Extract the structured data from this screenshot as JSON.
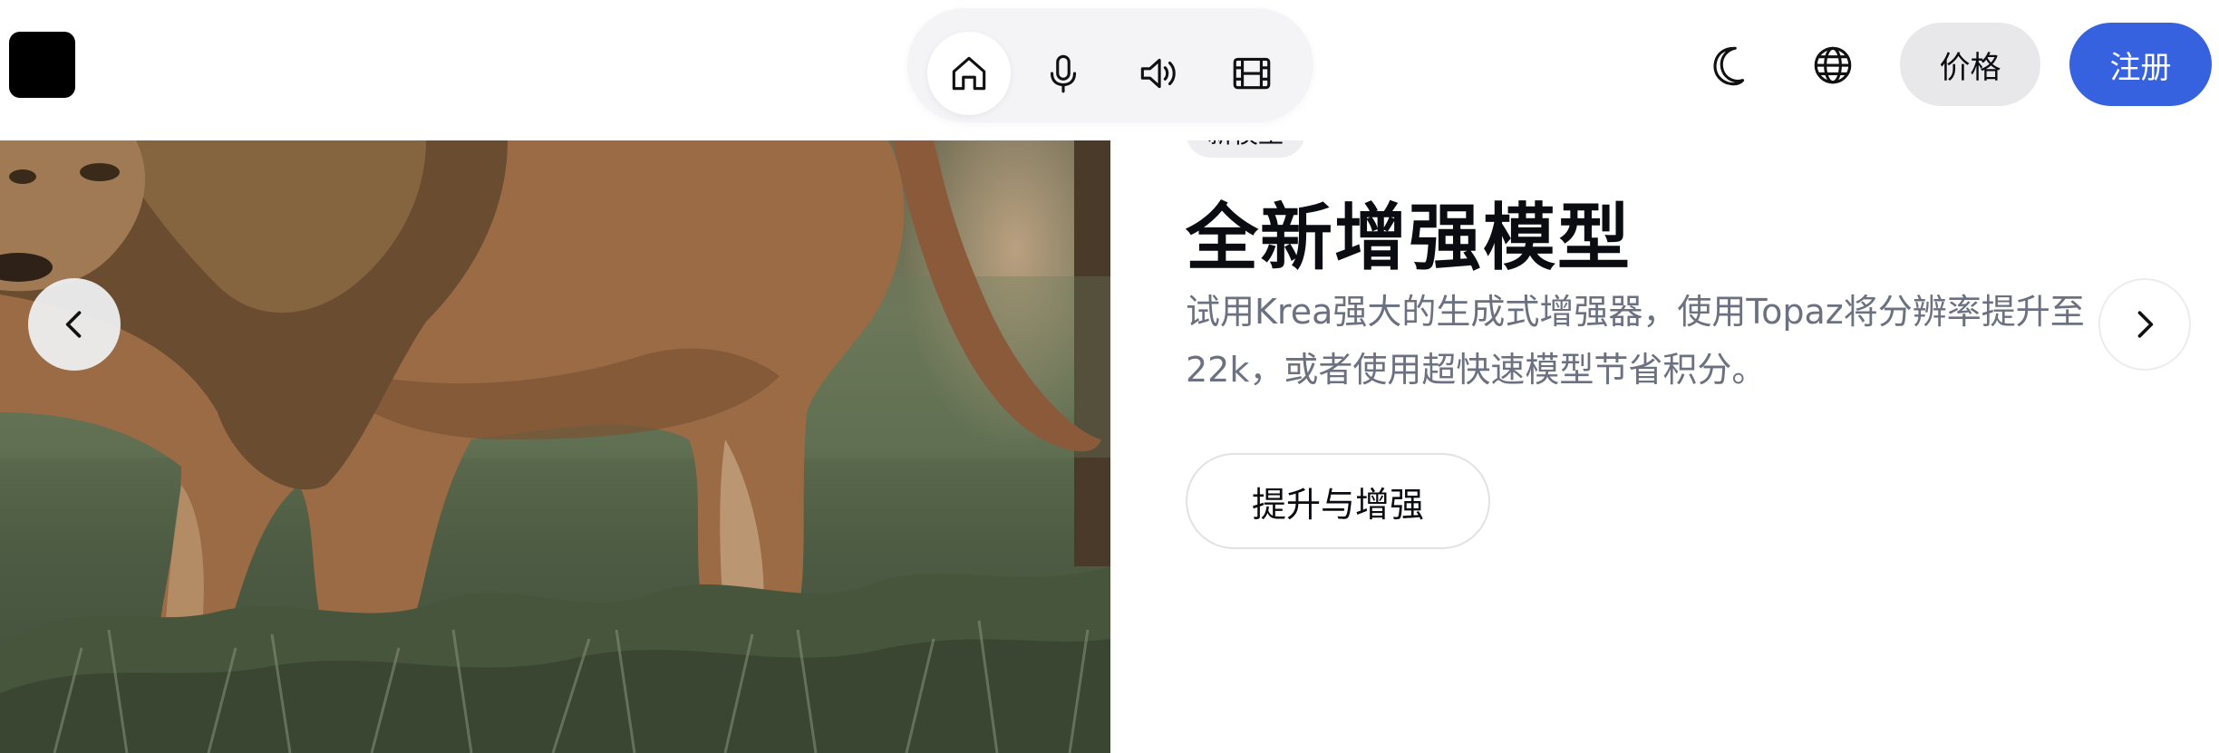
{
  "header": {
    "logo_label": "",
    "nav": [
      {
        "icon": "home-icon",
        "active": true
      },
      {
        "icon": "microphone-icon",
        "active": false
      },
      {
        "icon": "speaker-icon",
        "active": false
      },
      {
        "icon": "film-icon",
        "active": false
      }
    ],
    "theme_icon": "moon-icon",
    "language_icon": "globe-icon",
    "pricing_label": "价格",
    "signup_label": "注册"
  },
  "hero": {
    "badge": "新模型",
    "title": "全新增强模型",
    "description": "试用Krea强大的生成式增强器，使用Topaz将分辨率提升至22k，或者使用超快速模型节省积分。",
    "cta_label": "提升与增强",
    "image_subject": "lion walking in grass"
  },
  "carousel": {
    "prev_icon": "chevron-left-icon",
    "next_icon": "chevron-right-icon"
  },
  "colors": {
    "accent": "#3662e0",
    "pricing_bg": "#e8e8eb",
    "nav_pill_bg": "#f4f4f6",
    "text_primary": "#0b0b12",
    "text_secondary": "#6b7180"
  }
}
